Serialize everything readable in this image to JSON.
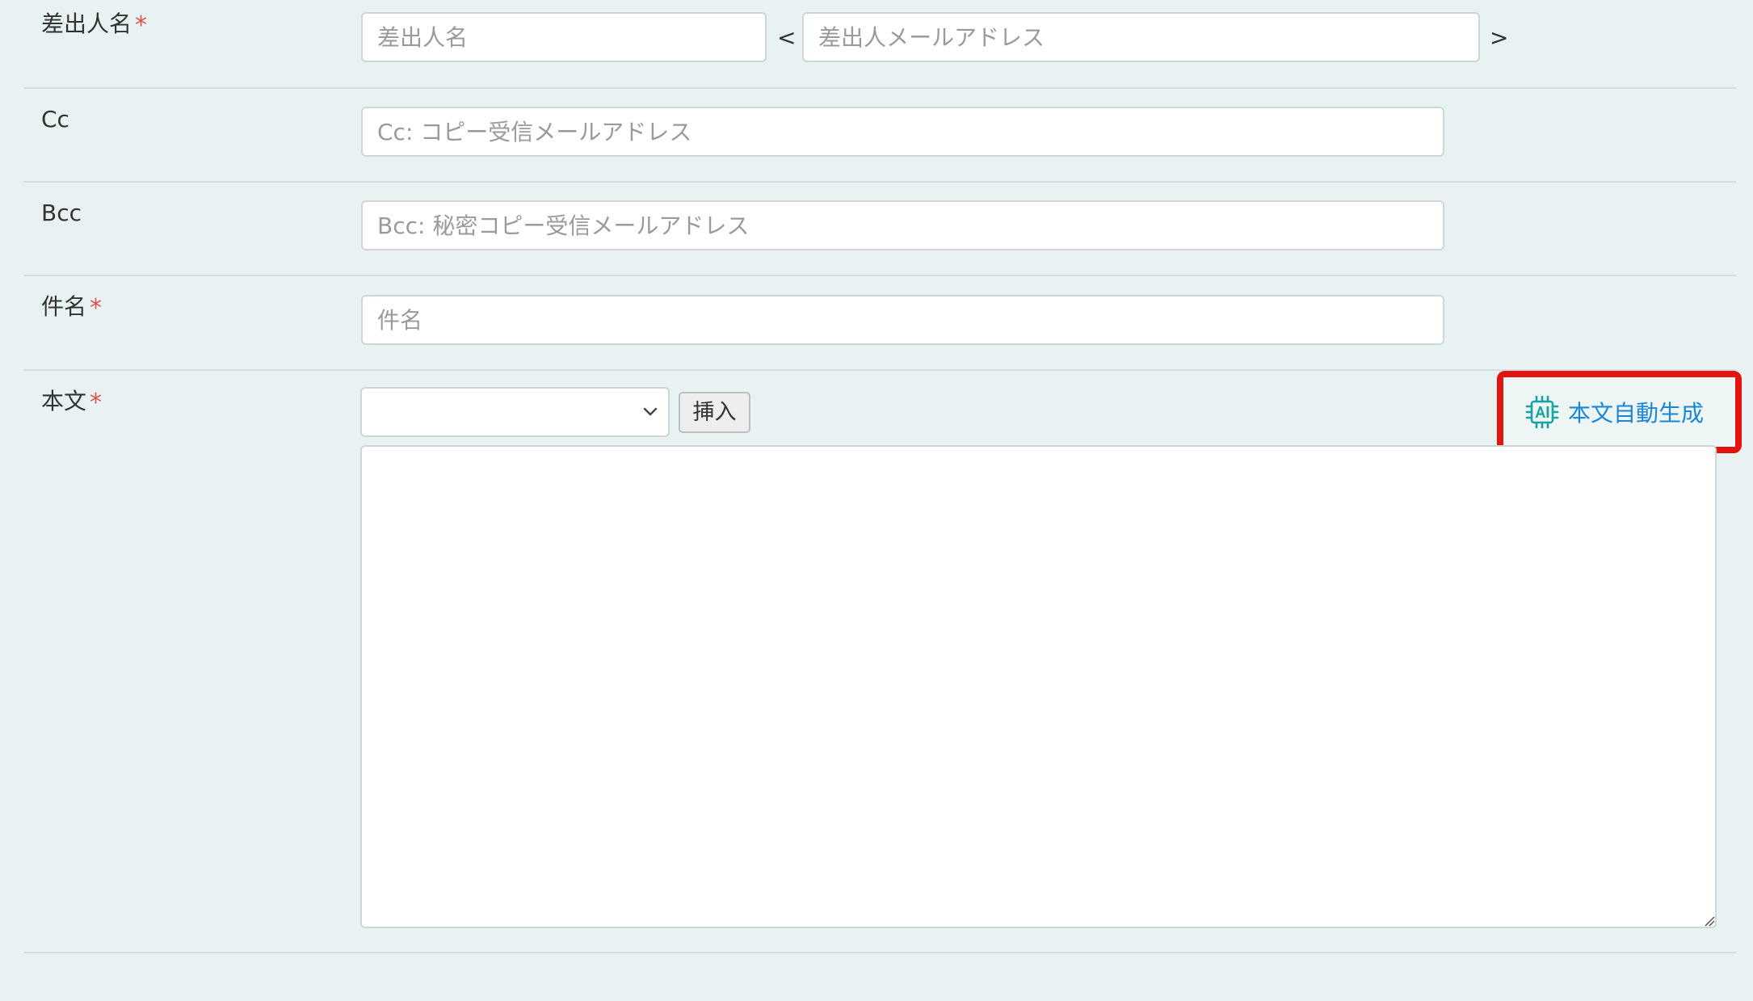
{
  "sender": {
    "label": "差出人名",
    "required_mark": "*",
    "name_placeholder": "差出人名",
    "bracket_open": "<",
    "email_placeholder": "差出人メールアドレス",
    "bracket_close": ">"
  },
  "cc": {
    "label": "Cc",
    "placeholder": "Cc: コピー受信メールアドレス"
  },
  "bcc": {
    "label": "Bcc",
    "placeholder": "Bcc: 秘密コピー受信メールアドレス"
  },
  "subject": {
    "label": "件名",
    "required_mark": "*",
    "placeholder": "件名"
  },
  "body": {
    "label": "本文",
    "required_mark": "*",
    "template_select_value": "",
    "insert_button_label": "挿入",
    "ai_button_label": "本文自動生成",
    "ai_icon": "ai-chip-icon",
    "ai_icon_color": "#1aa3a3",
    "ai_label_color": "#1a86d6",
    "highlight_color": "#e3140f"
  },
  "colors": {
    "background": "#e8f2f2",
    "required": "#d9534f",
    "divider": "#d5dfdf"
  }
}
